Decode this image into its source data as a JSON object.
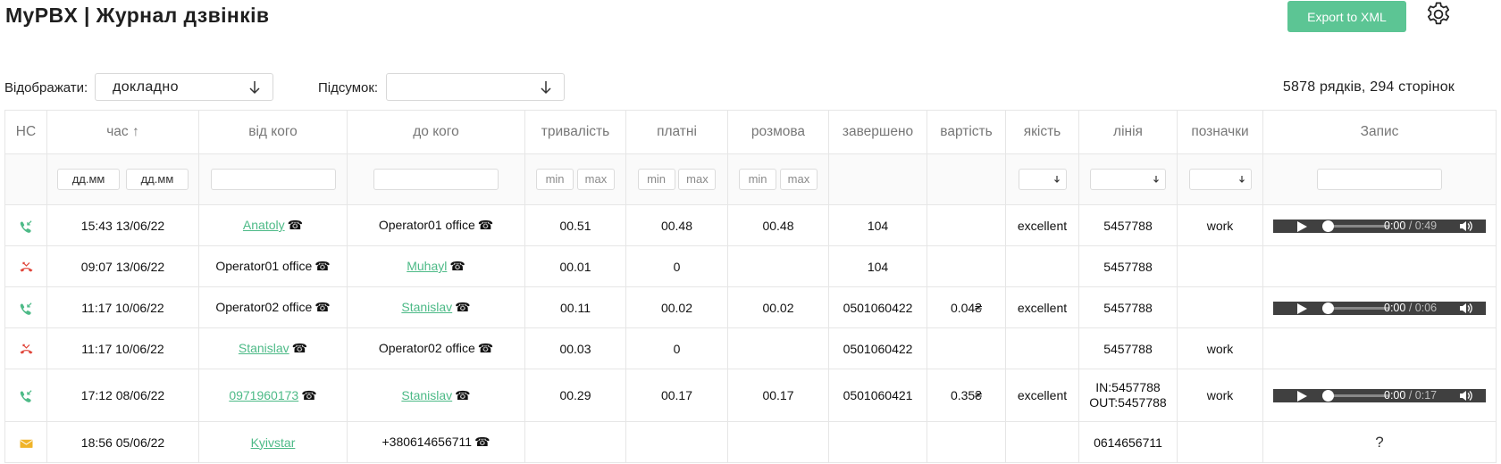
{
  "header": {
    "title": "MyPBX | Журнал дзвінків",
    "export_label": "Export to XML",
    "settings_icon": "gear-icon"
  },
  "filters": {
    "display_label": "Відображати:",
    "display_value": "докладно",
    "summary_label": "Підсумок:",
    "summary_value": "",
    "rows_info": "5878 рядків, 294 сторінок"
  },
  "columns": [
    "НС",
    "час ↑",
    "від кого",
    "до кого",
    "тривалість",
    "платні",
    "розмова",
    "завершено",
    "вартість",
    "якість",
    "лінія",
    "позначки",
    "Запис"
  ],
  "filter_row": {
    "date_placeholder": "дд.мм",
    "min": "min",
    "max": "max"
  },
  "colors": {
    "accent": "#5cc594",
    "link": "#4dba87",
    "answered": "#4dba87",
    "missed": "#e0453a",
    "sms": "#f0b429"
  },
  "rows": [
    {
      "status": "answered",
      "time": "15:43 13/06/22",
      "from": "Anatoly",
      "to": "Operator01 office",
      "duration": "00.51",
      "paid": "00.48",
      "talk": "00.48",
      "ended": "104",
      "cost": "",
      "quality": "excellent",
      "line": "5457788",
      "tags": "work",
      "rec_time": "0:00",
      "rec_dur": "0:49"
    },
    {
      "status": "missed",
      "time": "09:07 13/06/22",
      "from": "Operator01 office",
      "to": "Muhayl",
      "duration": "00.01",
      "paid": "0",
      "talk": "",
      "ended": "104",
      "cost": "",
      "quality": "",
      "line": "5457788",
      "tags": ""
    },
    {
      "status": "answered",
      "time": "11:17 10/06/22",
      "from": "Operator02 office",
      "to": "Stanislav",
      "duration": "00.11",
      "paid": "00.02",
      "talk": "00.02",
      "ended": "0501060422",
      "cost": "0.04₴",
      "quality": "excellent",
      "line": "5457788",
      "tags": "",
      "rec_time": "0:00",
      "rec_dur": "0:06"
    },
    {
      "status": "missed",
      "time": "11:17 10/06/22",
      "from": "Stanislav",
      "to": "Operator02 office",
      "duration": "00.03",
      "paid": "0",
      "talk": "",
      "ended": "0501060422",
      "cost": "",
      "quality": "",
      "line": "5457788",
      "tags": "work"
    },
    {
      "status": "answered",
      "time": "17:12 08/06/22",
      "from": "0971960173",
      "to": "Stanislav",
      "duration": "00.29",
      "paid": "00.17",
      "talk": "00.17",
      "ended": "0501060421",
      "cost": "0.35₴",
      "quality": "excellent",
      "line_in": "IN:5457788",
      "line_out": "OUT:5457788",
      "tags": "work",
      "rec_time": "0:00",
      "rec_dur": "0:17"
    },
    {
      "status": "sms",
      "time": "18:56 05/06/22",
      "from": "Kyivstar",
      "to": "+380614656711",
      "duration": "",
      "paid": "",
      "talk": "",
      "ended": "",
      "cost": "",
      "quality": "",
      "line": "0614656711",
      "tags": "",
      "record": "?"
    }
  ]
}
